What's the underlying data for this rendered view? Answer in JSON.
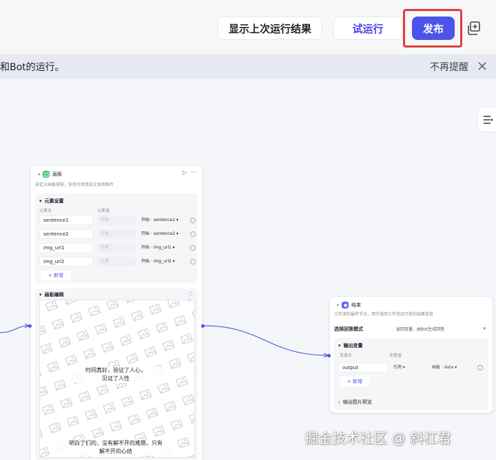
{
  "toolbar": {
    "show_last_result": "显示上次运行结果",
    "test_run": "试运行",
    "publish": "发布"
  },
  "notice": {
    "text": "和Bot的运行。",
    "dismiss": "不再提醒"
  },
  "canvas_node": {
    "title": "画板",
    "description": "自定义画板排版，支持引用添加文本和图片",
    "elements_section": "元素设置",
    "col_name": "元素名",
    "col_value": "元素值",
    "rows": [
      {
        "name": "sentence1",
        "type": "引用",
        "ref_node": "开始",
        "ref_var": "sentence1"
      },
      {
        "name": "sentence2",
        "type": "引用",
        "ref_node": "开始",
        "ref_var": "sentence2"
      },
      {
        "name": "img_url1",
        "type": "引用",
        "ref_node": "开始",
        "ref_var": "img_url1"
      },
      {
        "name": "img_url2",
        "type": "引用",
        "ref_node": "开始",
        "ref_var": "img_url2"
      }
    ],
    "add_label": "新增",
    "editor_section": "画板编辑",
    "poster_line1": "时间真好，验证了人心，",
    "poster_line2": "见证了人性",
    "poster_line3": "明白了们的，没有解不开的难题，只有",
    "poster_line4": "解不开的心结"
  },
  "end_node": {
    "title": "结束",
    "description": "工作流的最终节点，用于返回工作流运行后的结果信息",
    "mode_label": "选择回答模式",
    "mode_value": "返回变量，由Bot生成回答",
    "output_section": "输出变量",
    "col_name": "变量名",
    "col_value": "变量值",
    "output_name": "output",
    "output_type": "引用",
    "output_ref_node": "画板",
    "output_ref_var": "data",
    "add_label": "新增",
    "image_preview": "输出图片预览"
  },
  "watermark": "掘金技术社区 @ 斜杠君",
  "colors": {
    "accent": "#4d53e8",
    "highlight": "#e03c3c"
  }
}
